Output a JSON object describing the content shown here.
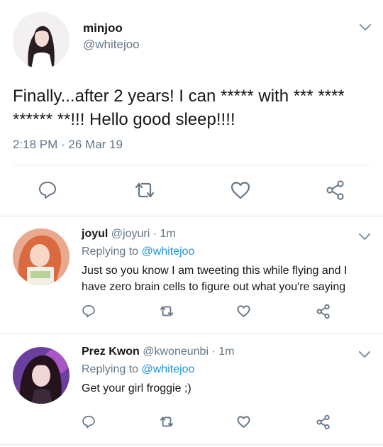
{
  "main_tweet": {
    "display_name": "minjoo",
    "handle": "@whitejoo",
    "text": "Finally...after 2 years! I can ***** with *** **** ****** **!!! Hello good sleep!!!!",
    "timestamp": "2:18 PM · 26 Mar 19",
    "menu_icon": "chevron-down-icon",
    "avatar_colors": [
      "#f1eff0",
      "#2b1f22",
      "#f3d9d2"
    ]
  },
  "replies": [
    {
      "display_name": "joyul",
      "handle": "@joyuri",
      "time": "· 1m",
      "replying_prefix": "Replying to",
      "replying_to": "@whitejoo",
      "text": "Just so you know I am tweeting this while flying and I have zero brain cells to figure out what you're saying"
    },
    {
      "display_name": "Prez Kwon",
      "handle": "@kwoneunbi",
      "time": "· 1m",
      "replying_prefix": "Replying to",
      "replying_to": "@whitejoo",
      "text": "Get your girl froggie ;)"
    }
  ],
  "actions": [
    "reply-icon",
    "retweet-icon",
    "like-icon",
    "share-icon"
  ],
  "colors": {
    "accent": "#1b95e0",
    "muted": "#657786",
    "icon": "#657786",
    "divider": "#e1e8ed"
  }
}
